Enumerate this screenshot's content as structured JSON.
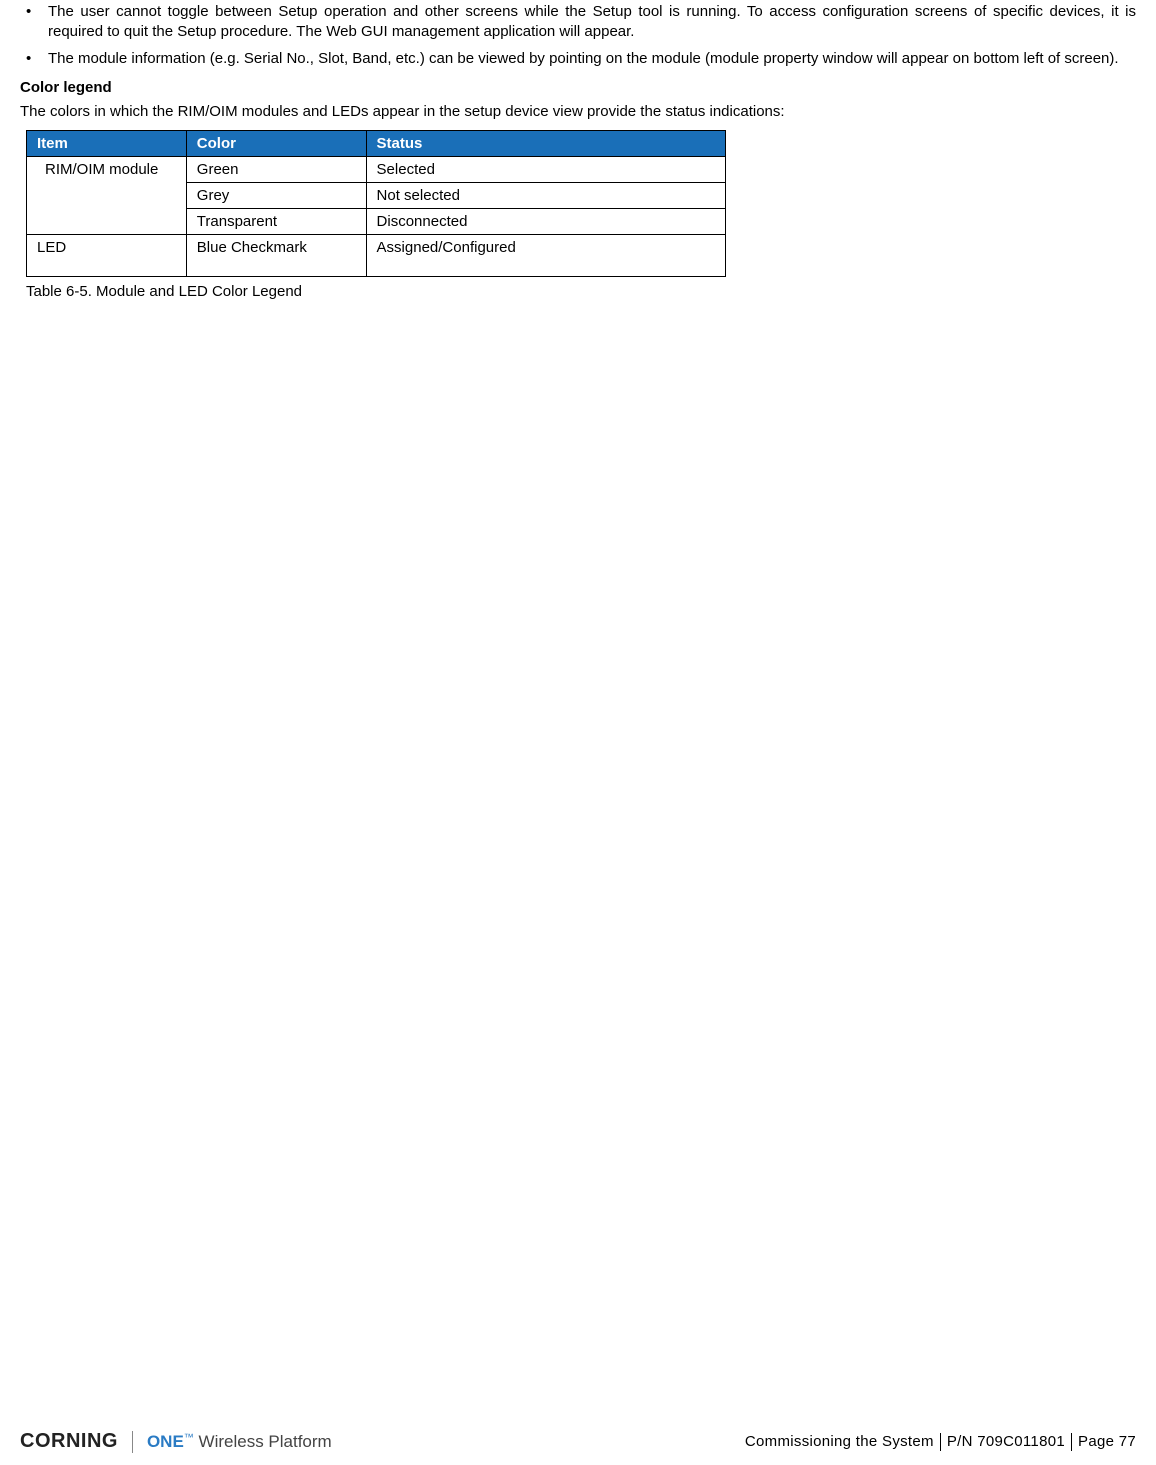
{
  "bullets": [
    "The user cannot toggle between Setup operation and other screens while the Setup tool is running. To access configuration screens of specific devices, it is required to quit the Setup procedure. The Web GUI management application will appear.",
    "The module information (e.g. Serial No., Slot, Band, etc.) can be viewed by pointing on the module (module property window will appear on bottom left of screen)."
  ],
  "heading": "Color legend",
  "intro": "The colors in which the RIM/OIM modules and LEDs appear in the setup device view provide the status indications:",
  "table": {
    "headers": {
      "c1": "Item",
      "c2": "Color",
      "c3": "Status"
    },
    "rows": [
      {
        "item": "RIM/OIM module",
        "color": "Green",
        "status": "Selected"
      },
      {
        "item": "",
        "color": "Grey",
        "status": "Not selected"
      },
      {
        "item": "",
        "color": "Transparent",
        "status": "Disconnected"
      },
      {
        "item": "LED",
        "color": "Blue Checkmark",
        "status": "Assigned/Configured"
      }
    ]
  },
  "caption": "Table 6-5. Module and LED Color Legend",
  "footer": {
    "brand1": "CORNING",
    "brand2_one": "ONE",
    "brand2_tm": "™",
    "brand2_rest": " Wireless Platform",
    "section": "Commissioning the System",
    "pn": "P/N 709C011801",
    "page": "Page 77"
  }
}
